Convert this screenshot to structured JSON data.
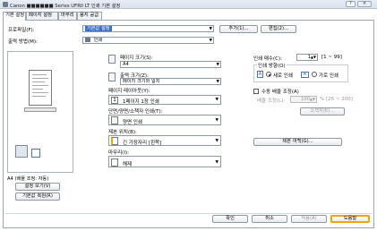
{
  "window": {
    "title": "Canon ■■■■■■ Series UFRII LT 인쇄 기본 설정"
  },
  "tabs": [
    "기본 설정",
    "페이지 설정",
    "마무리",
    "용지 공급"
  ],
  "profile": {
    "label": "프로파일(F):",
    "value": "기본값 설정",
    "add_button": "추가(1)...",
    "edit_button": "편집(2)..."
  },
  "output": {
    "label": "출력 방법(M):",
    "value": "인쇄"
  },
  "preview": {
    "caption": "A4 (배율 조정: 자동)",
    "settings_button": "설정 보기(V)",
    "restore_button": "기본값 복원(R)"
  },
  "page_size": {
    "label": "페이지 크기(S):",
    "value": "A4"
  },
  "output_size": {
    "label": "출력 크기(Z):",
    "value": "페이지 크기와 일치"
  },
  "layout": {
    "label": "페이지 레이아웃(Y):",
    "value": "1페이지 1장 인쇄"
  },
  "duplex": {
    "label": "단면/양면/소책자 인쇄(T):",
    "value": "양면 인쇄"
  },
  "binding": {
    "label": "제본 위치(B):",
    "value": "긴 가장자리 [왼쪽]",
    "button": "제본 여백(G)..."
  },
  "finishing": {
    "label": "마무리(I):",
    "value": "해제"
  },
  "copies": {
    "label": "인쇄 매수(C):",
    "value": "1",
    "range": "[1 ~ 99]"
  },
  "orientation": {
    "label": "인쇄 방향(O)",
    "portrait": "세로 인쇄",
    "landscape": "가로 인쇄",
    "selected": "portrait"
  },
  "manual_scaling": {
    "label": "수동 배율 조정(A)",
    "sub_label": "배율 조정(L):",
    "value": "100",
    "range": "% [25 ~ 200]",
    "checked": false
  },
  "booklet_button": "소책자(K)...",
  "footer": {
    "ok": "확인",
    "cancel": "취소",
    "apply": "적용(A)",
    "help": "도움말"
  },
  "colors": {
    "accent": "#f5a300",
    "selection": "#3b6fc4"
  }
}
